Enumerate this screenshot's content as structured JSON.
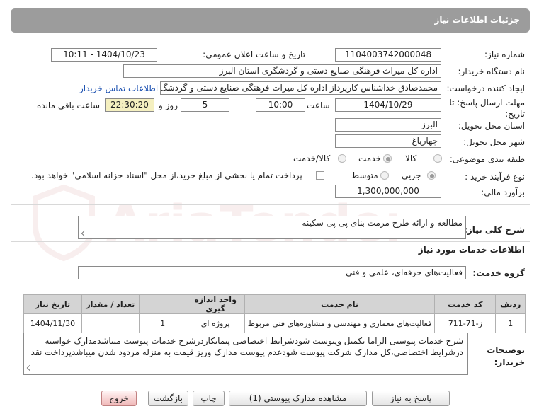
{
  "header": {
    "title": "جزئیات اطلاعات نیاز"
  },
  "form": {
    "need_number": {
      "label": "شماره نیاز:",
      "value": "1104003742000048"
    },
    "announce_datetime": {
      "label": "تاریخ و ساعت اعلان عمومی:",
      "value": "1404/10/23 - 10:11"
    },
    "buyer_org": {
      "label": "نام دستگاه خریدار:",
      "value": "اداره کل میراث فرهنگی  صنایع دستی و گردشگری استان البرز"
    },
    "requester": {
      "label": "ایجاد کننده درخواست:",
      "value": "محمدصادق خداشناس  کارپرداز اداره کل میراث فرهنگی  صنایع دستی و گردشگ",
      "contact_link": "اطلاعات تماس خریدار"
    },
    "deadline": {
      "label": "مهلت ارسال پاسخ: تا تاریخ:",
      "date": "1404/10/29",
      "time_label": "ساعت",
      "time": "10:00",
      "days": "5",
      "days_label": "روز و",
      "remaining": "22:30:20",
      "remaining_label": "ساعت باقی مانده"
    },
    "province": {
      "label": "استان محل تحویل:",
      "value": "البرز"
    },
    "city": {
      "label": "شهر محل تحویل:",
      "value": "چهارباغ"
    },
    "category": {
      "label": "طبقه بندی موضوعی:",
      "options": [
        "کالا",
        "خدمت",
        "کالا/خدمت"
      ],
      "selected": "خدمت"
    },
    "process": {
      "label": "نوع فرآیند خرید :",
      "options": [
        "جزیی",
        "متوسط"
      ],
      "selected": "جزیی",
      "payment_note": "پرداخت تمام یا بخشی از مبلغ خرید،از محل \"اسناد خزانه اسلامی\" خواهد بود."
    },
    "estimate": {
      "label": "برآورد مالی:",
      "value": "1,300,000,000"
    }
  },
  "summary": {
    "label": "شرح کلی نیاز:",
    "value": "مطالعه و ارائه طرح مرمت بنای پی پی سکینه"
  },
  "services": {
    "section_title": "اطلاعات خدمات مورد نیاز",
    "group_label": "گروه خدمت:",
    "group_value": "فعالیت‌های حرفه‌ای، علمی و فنی",
    "table": {
      "columns": [
        "ردیف",
        "کد خدمت",
        "نام خدمت",
        "واحد اندازه گیری",
        "تعداد / مقدار",
        "تاریخ نیاز"
      ],
      "rows": [
        [
          "1",
          "ز-71-711",
          "فعالیت‌های معماری و مهندسی و مشاوره‌های فنی مربوط",
          "پروژه ای",
          "1",
          "1404/11/30"
        ]
      ]
    }
  },
  "notes": {
    "label": "توضیحات خریدار:",
    "value": "شرح خدمات پیوستی الزاما تکمیل وپیوست شودشرایط اختصاصی پیمانکاردرشرح خدمات پیوست میباشدمدارک خواسته درشرایط اختصاصی،کل مدارک شرکت پیوست شودعدم پیوست مدارک وریز قیمت به منزله مردود شدن میباشدپرداخت نقد"
  },
  "buttons": {
    "reply": "پاسخ به نیاز",
    "attachments": "مشاهده مدارک پیوستی (1)",
    "print": "چاپ",
    "back": "بازگشت",
    "exit": "خروج"
  },
  "watermark": {
    "text": "AriaTender.net"
  },
  "colors": {
    "title_bar": "#9c9c9c",
    "link": "#1a4fb0",
    "highlight": "#f5f0c0",
    "exit_button": "#f0b8b8"
  }
}
